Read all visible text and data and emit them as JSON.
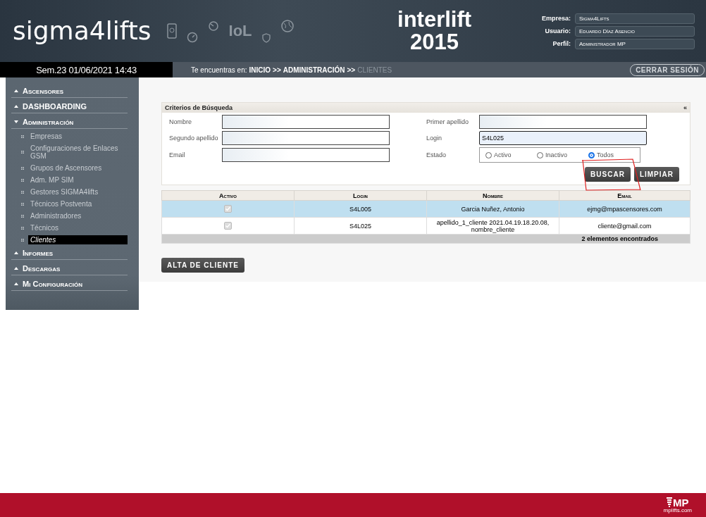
{
  "header": {
    "logo": "sigma4lifts",
    "iot_label": "IoL",
    "event": {
      "name": "interlift",
      "year": "2015"
    },
    "profile": [
      {
        "label": "Empresa:",
        "value": "Sigma4Lifts"
      },
      {
        "label": "Usuario:",
        "value": "Eduardo Díaz Asencio"
      },
      {
        "label": "Perfil:",
        "value": "Administrador MP"
      }
    ]
  },
  "datetime": "Sem.23 01/06/2021 14:43",
  "breadcrumb": {
    "prefix": "Te encuentras en:",
    "items": [
      {
        "kind": "link",
        "text": "INICIO"
      },
      {
        "kind": "separator",
        "text": ">>"
      },
      {
        "kind": "link",
        "text": "ADMINISTRACIÓN"
      },
      {
        "kind": "separator",
        "text": ">>"
      },
      {
        "kind": "current",
        "text": "CLIENTES"
      }
    ]
  },
  "logout": "CERRAR SESIÓN",
  "sidebar": [
    {
      "label": "Ascensores",
      "expanded": false
    },
    {
      "label": "DASHBOARDING",
      "expanded": false
    },
    {
      "label": "Administración",
      "expanded": true,
      "children": [
        {
          "label": "Empresas",
          "selected": false
        },
        {
          "label": "Configuraciones de Enlaces GSM",
          "selected": false
        },
        {
          "label": "Grupos de Ascensores",
          "selected": false
        },
        {
          "label": "Adm. MP SIM",
          "selected": false
        },
        {
          "label": "Gestores SIGMA4lifts",
          "selected": false
        },
        {
          "label": "Técnicos Postventa",
          "selected": false
        },
        {
          "label": "Administradores",
          "selected": false
        },
        {
          "label": "Técnicos",
          "selected": false
        },
        {
          "label": "Clientes",
          "selected": true
        }
      ]
    },
    {
      "label": "Informes",
      "expanded": false
    },
    {
      "label": "Descargas",
      "expanded": false
    },
    {
      "label": "Mi Configuración",
      "expanded": false
    }
  ],
  "search": {
    "title": "Criterios de Búsqueda",
    "collapse": "«",
    "fields": [
      {
        "label": "Nombre"
      },
      {
        "label": "Primer apellido"
      },
      {
        "label": "Segundo apellido"
      },
      {
        "label": "Login",
        "value": "S4L025"
      },
      {
        "label": "Email"
      }
    ],
    "estado": {
      "label": "Estado",
      "options": [
        {
          "label": "Activo",
          "selected": false
        },
        {
          "label": "Inactivo",
          "selected": false
        },
        {
          "label": "Todos",
          "selected": true
        }
      ]
    },
    "buttons": [
      "BUSCAR",
      "LIMPIAR"
    ]
  },
  "table": {
    "columns": [
      "Activo",
      "Login",
      "Nombre",
      "Email"
    ],
    "rows": [
      {
        "activo": {
          "checked": true,
          "disabled": true
        },
        "login": "S4L005",
        "nombre": "Garcia Nuñez, Antonio",
        "email": "ejmg@mpascensores.com",
        "selected": true
      },
      {
        "activo": {
          "checked": true,
          "disabled": true
        },
        "login": "S4L025",
        "nombre": "apellido_1_cliente 2021.04.19.18.20.08, nombre_cliente",
        "email": "cliente@gmail.com",
        "selected": false
      }
    ],
    "footer": "2 elementos encontrados"
  },
  "add_button": "ALTA DE CLIENTE",
  "footer": {
    "brand": "MP",
    "site": "mplifts.com"
  }
}
